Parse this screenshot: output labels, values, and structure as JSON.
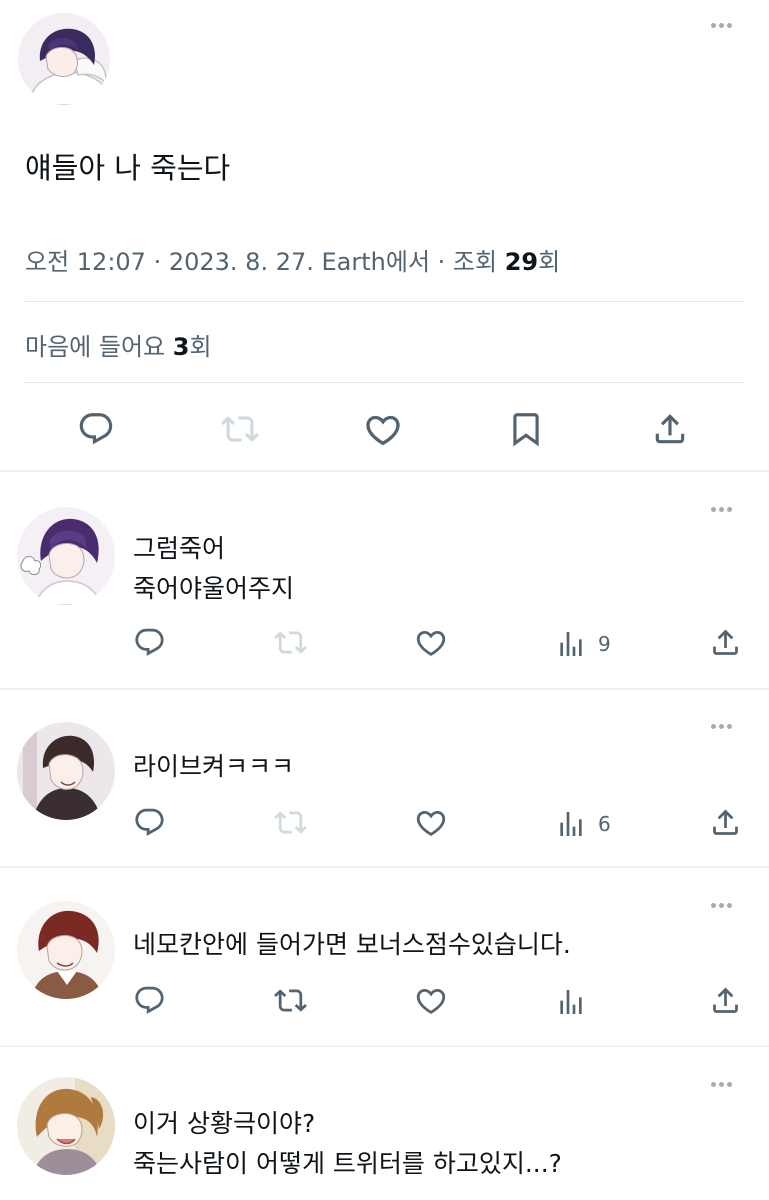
{
  "tweet": {
    "text": "얘들아 나 죽는다",
    "meta_prefix": "오전 12:07 · 2023. 8. 27. Earth에서 · 조회 ",
    "view_count": "29",
    "meta_suffix": "회",
    "likes_prefix": "마음에 들어요 ",
    "like_count": "3",
    "likes_suffix": "회"
  },
  "replies": [
    {
      "lines": [
        "그럼죽어",
        "죽어야울어주지"
      ],
      "view_count": "9"
    },
    {
      "lines": [
        "라이브켜ㅋㅋㅋ"
      ],
      "view_count": "6"
    },
    {
      "lines": [
        "네모칸안에 들어가면 보너스점수있습니다."
      ],
      "view_count": ""
    },
    {
      "lines": [
        "이거 상황극이야?",
        "죽는사람이 어떻게 트위터를 하고있지...?"
      ]
    }
  ],
  "colors": {
    "text": "#0f1419",
    "secondary": "#536471",
    "icon": "#536471",
    "disabled_icon": "#cfd9de",
    "divider": "#eff3f4"
  },
  "icons": [
    "more-icon",
    "reply-icon",
    "retweet-icon",
    "like-icon",
    "bookmark-icon",
    "share-icon",
    "views-icon"
  ]
}
